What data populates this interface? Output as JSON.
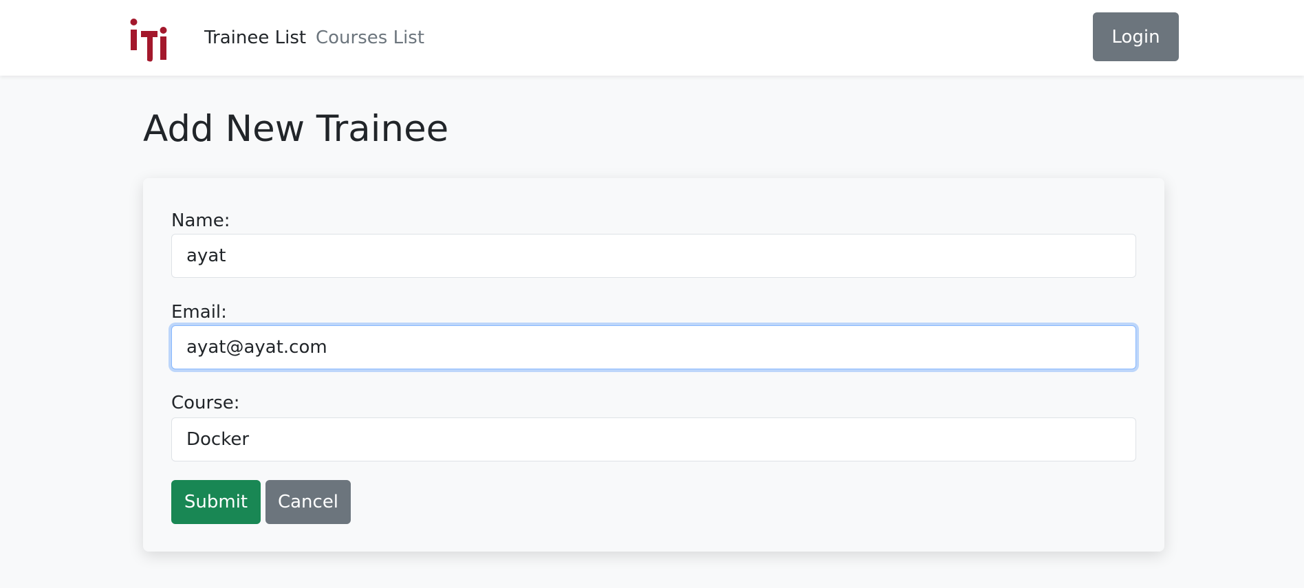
{
  "navbar": {
    "logo_text": "iTi",
    "links": [
      {
        "label": "Trainee List",
        "active": true
      },
      {
        "label": "Courses List",
        "active": false
      }
    ],
    "login_label": "Login"
  },
  "page": {
    "title": "Add New Trainee"
  },
  "form": {
    "name": {
      "label": "Name:",
      "value": "ayat"
    },
    "email": {
      "label": "Email:",
      "value": "ayat@ayat.com",
      "focused": true
    },
    "course": {
      "label": "Course:",
      "value": "Docker"
    },
    "submit_label": "Submit",
    "cancel_label": "Cancel"
  },
  "colors": {
    "brand": "#a3182c",
    "submit": "#198754",
    "secondary": "#6c757d",
    "focus": "#86b7fe"
  }
}
